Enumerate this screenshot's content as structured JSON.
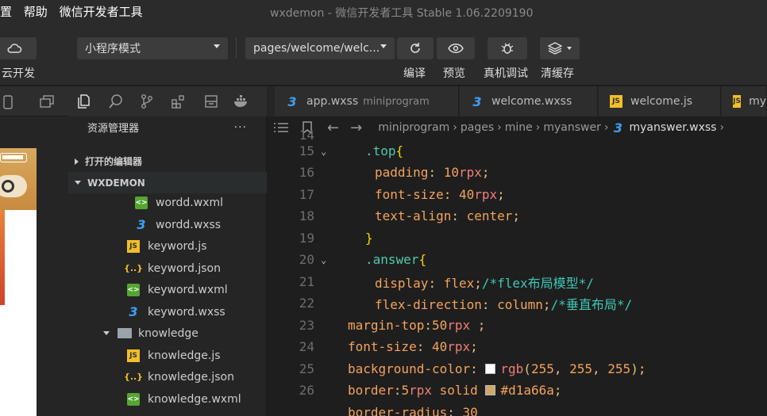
{
  "titlebar": {
    "menu": [
      "置",
      "帮助",
      "微信开发者工具"
    ],
    "title": "wxdemon - 微信开发者工具 Stable 1.06.2209190"
  },
  "toolbar": {
    "cloud_label": "云开发",
    "mode_select": "小程序模式",
    "page_select": "pages/welcome/welc...",
    "compile_label": "编译",
    "preview_label": "预览",
    "debug_label": "真机调试",
    "cache_label": "清缓存"
  },
  "explorer": {
    "title": "资源管理器",
    "more": "···",
    "open_editors": "打开的编辑器",
    "project": "WXDEMON",
    "files": [
      {
        "name": "wordd.wxml",
        "type": "wxml"
      },
      {
        "name": "wordd.wxss",
        "type": "wxss"
      },
      {
        "name": "keyword.js",
        "type": "js"
      },
      {
        "name": "keyword.json",
        "type": "json"
      },
      {
        "name": "keyword.wxml",
        "type": "wxml"
      },
      {
        "name": "keyword.wxss",
        "type": "wxss"
      },
      {
        "name": "knowledge",
        "type": "folder"
      },
      {
        "name": "knowledge.js",
        "type": "js"
      },
      {
        "name": "knowledge.json",
        "type": "json"
      },
      {
        "name": "knowledge.wxml",
        "type": "wxml"
      }
    ]
  },
  "tabs": [
    {
      "label": "app.wxss",
      "sub": "miniprogram",
      "type": "wxss"
    },
    {
      "label": "welcome.wxss",
      "sub": "",
      "type": "wxss"
    },
    {
      "label": "welcome.js",
      "sub": "",
      "type": "js"
    },
    {
      "label": "my",
      "sub": "",
      "type": "js"
    }
  ],
  "breadcrumbs": [
    "miniprogram",
    "pages",
    "mine",
    "myanswer",
    "myanswer.wxss"
  ],
  "code": {
    "line_numbers": [
      "14",
      "15",
      "16",
      "17",
      "18",
      "19",
      "20",
      "21",
      "22",
      "23",
      "24",
      "25",
      "26"
    ],
    "swatch_white": "#ffffff",
    "swatch_brown": "#d1a66a"
  }
}
